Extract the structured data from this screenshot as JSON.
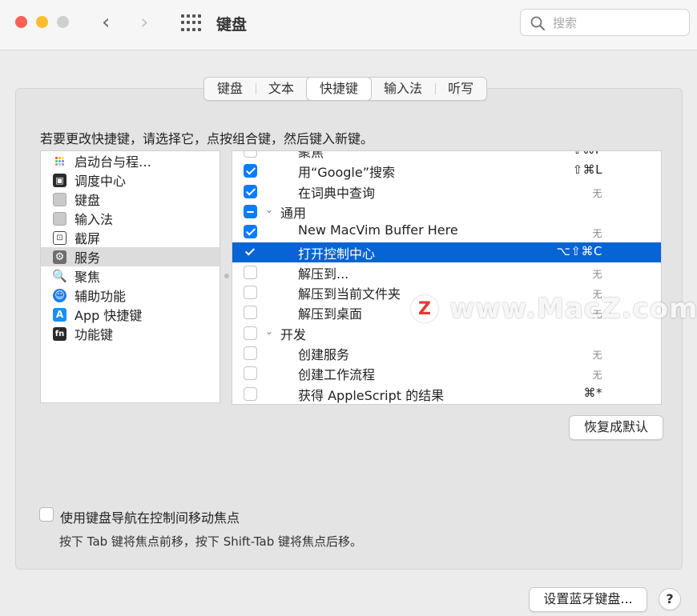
{
  "window": {
    "title": "键盘",
    "search_placeholder": "搜索"
  },
  "tabs": [
    {
      "label": "键盘",
      "active": false
    },
    {
      "label": "文本",
      "active": false
    },
    {
      "label": "快捷键",
      "active": true
    },
    {
      "label": "输入法",
      "active": false
    },
    {
      "label": "听写",
      "active": false
    }
  ],
  "instruction": "若要更改快捷键，请选择它，点按组合键，然后键入新键。",
  "categories": [
    {
      "label": "启动台与程…",
      "icon": "launchpad-icon"
    },
    {
      "label": "调度中心",
      "icon": "mission-control-icon"
    },
    {
      "label": "键盘",
      "icon": "keyboard-icon"
    },
    {
      "label": "输入法",
      "icon": "keyboard-icon"
    },
    {
      "label": "截屏",
      "icon": "screenshot-icon"
    },
    {
      "label": "服务",
      "icon": "gear-icon",
      "selected": true
    },
    {
      "label": "聚焦",
      "icon": "magnifier-icon"
    },
    {
      "label": "辅助功能",
      "icon": "accessibility-icon"
    },
    {
      "label": "App 快捷键",
      "icon": "app-store-icon"
    },
    {
      "label": "功能键",
      "icon": "fn-key-icon"
    }
  ],
  "shortcuts": [
    {
      "type": "item",
      "label": "聚焦",
      "checked": false,
      "shortcut": "⇧⌘F",
      "partial": true
    },
    {
      "type": "item",
      "label": "用“Google”搜索",
      "checked": true,
      "shortcut": "⇧⌘L"
    },
    {
      "type": "item",
      "label": "在词典中查询",
      "checked": true,
      "shortcut": "无"
    },
    {
      "type": "group",
      "label": "通用",
      "state": "mixed"
    },
    {
      "type": "item",
      "label": "New MacVim Buffer Here",
      "checked": true,
      "shortcut": "无"
    },
    {
      "type": "item",
      "label": "打开控制中心",
      "checked": true,
      "shortcut": "⌥⇧⌘C",
      "selected": true
    },
    {
      "type": "item",
      "label": "解压到...",
      "checked": false,
      "shortcut": "无"
    },
    {
      "type": "item",
      "label": "解压到当前文件夹",
      "checked": false,
      "shortcut": "无"
    },
    {
      "type": "item",
      "label": "解压到桌面",
      "checked": false,
      "shortcut": "无"
    },
    {
      "type": "group",
      "label": "开发",
      "state": "off"
    },
    {
      "type": "item",
      "label": "创建服务",
      "checked": false,
      "shortcut": "无"
    },
    {
      "type": "item",
      "label": "创建工作流程",
      "checked": false,
      "shortcut": "无"
    },
    {
      "type": "item",
      "label": "获得 AppleScript 的结果",
      "checked": false,
      "shortcut": "⌘*"
    }
  ],
  "watermark": {
    "logo": "Z",
    "text": "www.MacZ.com"
  },
  "restore_defaults": "恢复成默认",
  "keyboard_navigation": {
    "label": "使用键盘导航在控制间移动焦点",
    "checked": false,
    "hint": "按下 Tab 键将焦点前移，按下 Shift-Tab 键将焦点后移。"
  },
  "bluetooth_button": "设置蓝牙键盘...",
  "help_button": "?",
  "colors": {
    "accent": "#0a7cff",
    "selection": "#0863d4"
  }
}
